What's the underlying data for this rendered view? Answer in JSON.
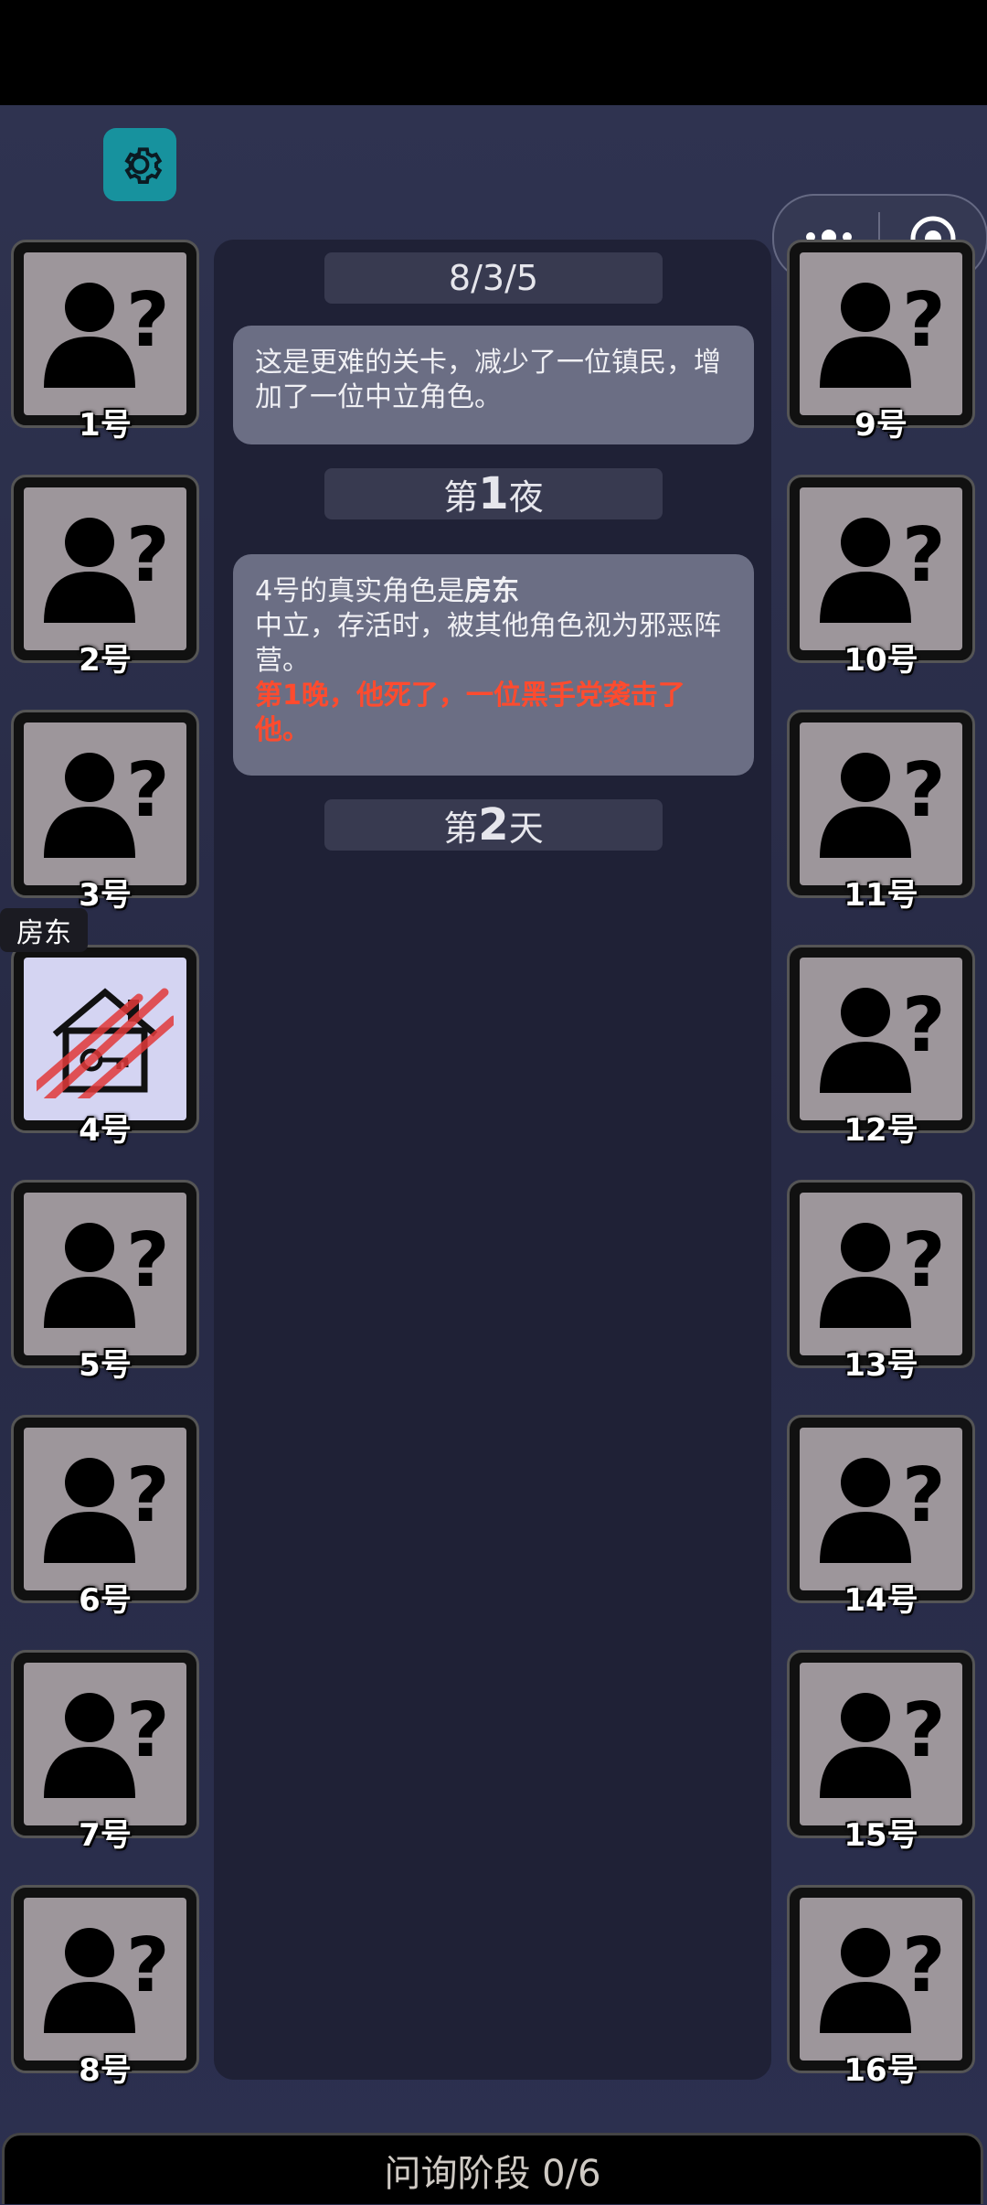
{
  "header": {
    "settings_icon": "gear-icon",
    "menu_icon": "more-dots-icon",
    "close_icon": "target-circle-icon"
  },
  "game": {
    "config_label": "8/3/5",
    "intro_message": "这是更难的关卡，减少了一位镇民，增加了一位中立角色。",
    "phase_night": {
      "prefix": "第",
      "number": "1",
      "suffix": "夜"
    },
    "reveal_message": {
      "line1_prefix": "4号的真实角色是",
      "line1_role": "房东",
      "line2": "中立，存活时，被其他角色视为邪恶阵营。",
      "death_note": "第1晚，他死了，一位黑手党袭击了他。"
    },
    "phase_day": {
      "prefix": "第",
      "number": "2",
      "suffix": "天"
    }
  },
  "players_left": [
    {
      "label": "1号",
      "icon": "unknown-person-icon"
    },
    {
      "label": "2号",
      "icon": "unknown-person-icon"
    },
    {
      "label": "3号",
      "icon": "unknown-person-icon"
    },
    {
      "label": "4号",
      "icon": "landlord-house-icon",
      "role": "房东",
      "status": "dead"
    },
    {
      "label": "5号",
      "icon": "unknown-person-icon"
    },
    {
      "label": "6号",
      "icon": "unknown-person-icon"
    },
    {
      "label": "7号",
      "icon": "unknown-person-icon"
    },
    {
      "label": "8号",
      "icon": "unknown-person-icon"
    }
  ],
  "players_right": [
    {
      "label": "9号",
      "icon": "unknown-person-icon"
    },
    {
      "label": "10号",
      "icon": "unknown-person-icon"
    },
    {
      "label": "11号",
      "icon": "unknown-person-icon"
    },
    {
      "label": "12号",
      "icon": "unknown-person-icon"
    },
    {
      "label": "13号",
      "icon": "unknown-person-icon"
    },
    {
      "label": "14号",
      "icon": "unknown-person-icon"
    },
    {
      "label": "15号",
      "icon": "unknown-person-icon"
    },
    {
      "label": "16号",
      "icon": "unknown-person-icon"
    }
  ],
  "footer": {
    "status": "问询阶段 0/6"
  },
  "colors": {
    "accent": "#17929e",
    "death_text": "#ff4b2e",
    "panel": "#1f2136"
  }
}
